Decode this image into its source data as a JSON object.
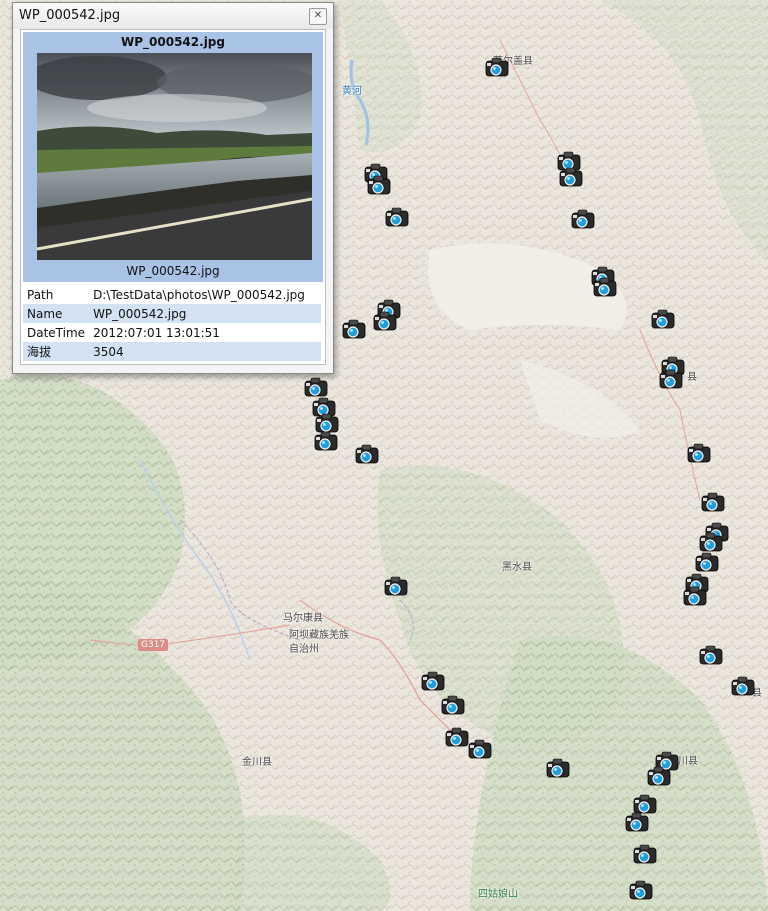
{
  "popup": {
    "window_title": "WP_000542.jpg",
    "close_icon": "close-icon",
    "photo_title": "WP_000542.jpg",
    "photo_caption": "WP_000542.jpg",
    "attributes": [
      {
        "key": "Path",
        "value": "D:\\TestData\\photos\\WP_000542.jpg"
      },
      {
        "key": "Name",
        "value": "WP_000542.jpg"
      },
      {
        "key": "DateTime",
        "value": "2012:07:01 13:01:51"
      },
      {
        "key": "海拔",
        "value": "3504"
      }
    ]
  },
  "map": {
    "labels": {
      "county_top": "若尔盖县",
      "river": "黄河",
      "county_right_1": "县",
      "heishui": "黑水县",
      "maerkang": "马尔康县",
      "aba_line1": "阿坝藏族羌族",
      "aba_line2": "自治州",
      "road_badge": "G317",
      "jinchuan": "金川县",
      "county_right_2": "县",
      "xiaojin": "小川县",
      "siguniang": "四姑娘山"
    },
    "marker_icon": "camera-icon",
    "colors": {
      "marker_body": "#2b2b2b",
      "marker_lens": "#1e9fe0",
      "popup_header": "#a9c3e6",
      "row_alt": "#d2e2f3"
    }
  }
}
